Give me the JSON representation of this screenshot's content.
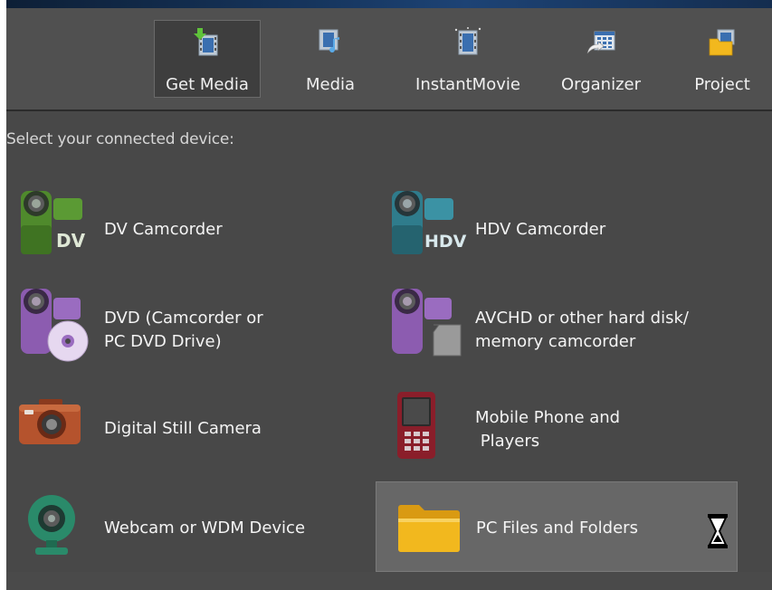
{
  "toolbar": {
    "items": [
      {
        "label": "Get Media",
        "icon": "get-media-icon",
        "active": true
      },
      {
        "label": "Media",
        "icon": "media-icon",
        "active": false
      },
      {
        "label": "InstantMovie",
        "icon": "instantmovie-icon",
        "active": false
      },
      {
        "label": "Organizer",
        "icon": "organizer-icon",
        "active": false
      },
      {
        "label": "Project",
        "icon": "project-icon",
        "active": false
      }
    ]
  },
  "prompt": "Select your connected device:",
  "devices": [
    {
      "label": "DV Camcorder",
      "icon": "dv-camcorder-icon",
      "badge": "DV"
    },
    {
      "label": "HDV Camcorder",
      "icon": "hdv-camcorder-icon",
      "badge": "HDV"
    },
    {
      "label": "DVD (Camcorder or\nPC DVD Drive)",
      "icon": "dvd-camcorder-icon"
    },
    {
      "label": "AVCHD or other hard disk/\nmemory camcorder",
      "icon": "avchd-camcorder-icon"
    },
    {
      "label": "Digital Still Camera",
      "icon": "digital-camera-icon"
    },
    {
      "label": "Mobile Phone and\n Players",
      "icon": "mobile-phone-icon"
    },
    {
      "label": "Webcam or WDM Device",
      "icon": "webcam-icon"
    },
    {
      "label": "PC Files and Folders",
      "icon": "folder-icon",
      "selected": true
    }
  ],
  "status_icon": "hourglass-icon",
  "colors": {
    "panel": "#484848",
    "toolbar": "#505050",
    "selected": "#676767",
    "dv_green": "#4f8a2c",
    "hdv_teal": "#2f7c8c",
    "purple": "#8c5cb0",
    "camera_orange": "#b5532d",
    "phone_red": "#8a1e2a",
    "webcam_green": "#2a8a6a",
    "folder_yellow": "#f2b81e"
  }
}
